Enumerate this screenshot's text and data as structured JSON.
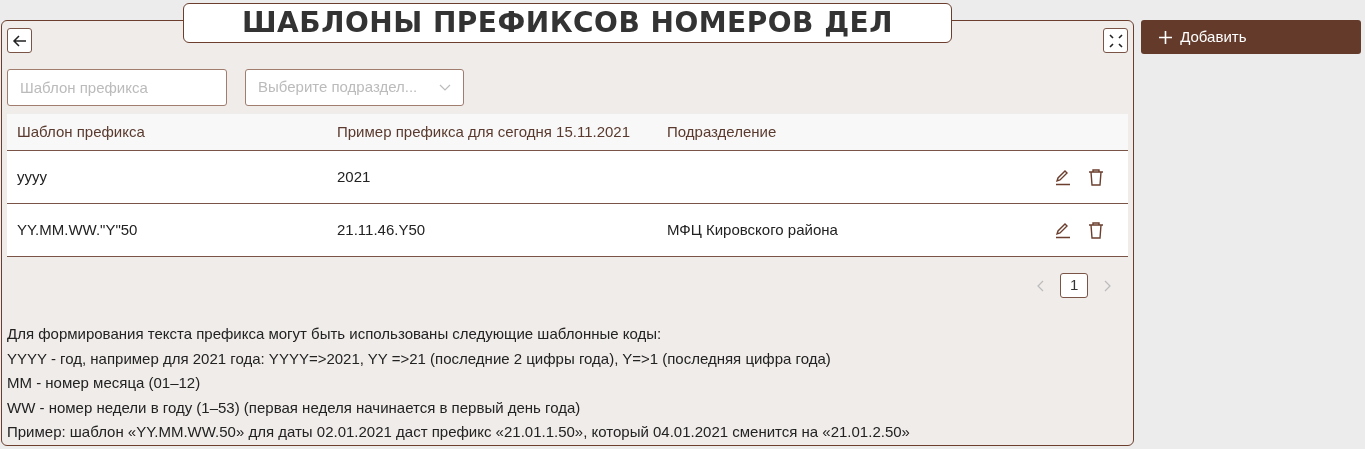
{
  "title": "ШАБЛОНЫ ПРЕФИКСОВ НОМЕРОВ ДЕЛ",
  "filters": {
    "template": {
      "placeholder": "Шаблон префикса"
    },
    "division": {
      "placeholder": "Выберите подраздел..."
    }
  },
  "table": {
    "columns": [
      "Шаблон префикса",
      "Пример префикса для сегодня 15.11.2021",
      "Подразделение"
    ],
    "rows": [
      {
        "cells": [
          "yyyy",
          "2021",
          ""
        ]
      },
      {
        "cells": [
          "YY.MM.WW.\"Y\"50",
          "21.11.46.Y50",
          "МФЦ Кировского района"
        ]
      }
    ]
  },
  "pagination": {
    "pages": [
      {
        "label": "1",
        "selected": true
      }
    ]
  },
  "help": [
    "Для формирования текста префикса могут быть использованы следующие шаблонные коды:",
    "YYYY - год, например для 2021 года: YYYY=>2021, YY =>21 (последние 2 цифры года), Y=>1 (последняя цифра года)",
    "MM - номер месяца (01–12)",
    "WW - номер недели в году (1–53) (первая неделя начинается в первый день года)",
    "Пример: шаблон «YY.MM.WW.50» для даты 02.01.2021 даст префикс «21.01.1.50», который 04.01.2021 сменится на «21.01.2.50»"
  ],
  "add_button": {
    "label": "Добавить"
  }
}
